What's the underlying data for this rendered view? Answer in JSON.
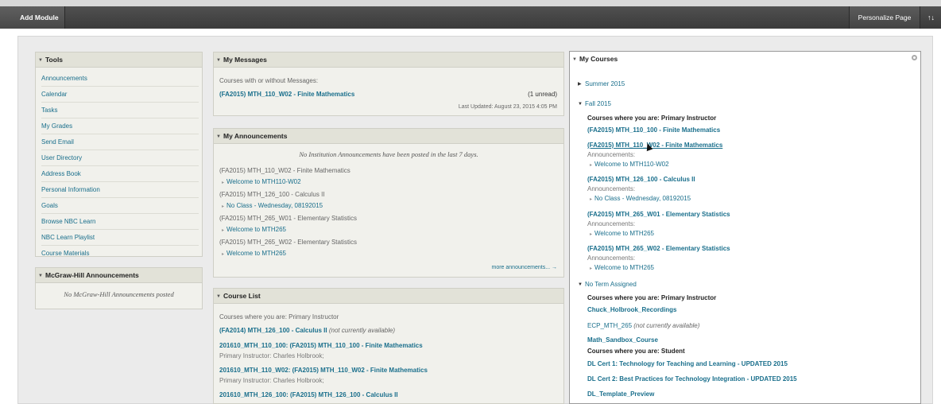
{
  "toolbar": {
    "add_module": "Add Module",
    "personalize_page": "Personalize Page",
    "sort_icon": "↑↓"
  },
  "tools": {
    "title": "Tools",
    "items": [
      "Announcements",
      "Calendar",
      "Tasks",
      "My Grades",
      "Send Email",
      "User Directory",
      "Address Book",
      "Personal Information",
      "Goals",
      "Browse NBC Learn",
      "NBC Learn Playlist",
      "Course Materials"
    ]
  },
  "mcgraw": {
    "title": "McGraw-Hill Announcements",
    "empty": "No McGraw-Hill Announcements posted"
  },
  "messages": {
    "title": "My Messages",
    "intro": "Courses with or without Messages:",
    "course": "(FA2015) MTH_110_W02 - Finite Mathematics",
    "unread": "(1 unread)",
    "updated": "Last Updated: August 23, 2015 4:05 PM"
  },
  "announcements": {
    "title": "My Announcements",
    "none": "No Institution Announcements have been posted in the last 7 days.",
    "items": [
      {
        "course": "(FA2015) MTH_110_W02 - Finite Mathematics",
        "link": "Welcome to MTH110-W02"
      },
      {
        "course": "(FA2015) MTH_126_100 - Calculus II",
        "link": "No Class - Wednesday, 08192015"
      },
      {
        "course": "(FA2015) MTH_265_W01 - Elementary Statistics",
        "link": "Welcome to MTH265"
      },
      {
        "course": "(FA2015) MTH_265_W02 - Elementary Statistics",
        "link": "Welcome to MTH265"
      }
    ],
    "more": "more announcements... →"
  },
  "course_list": {
    "title": "Course List",
    "role": "Courses where you are: Primary Instructor",
    "c1": "(FA2014) MTH_126_100 - Calculus II",
    "c1_note": "(not currently available)",
    "c2": "201610_MTH_110_100: (FA2015) MTH_110_100 - Finite Mathematics",
    "c2_sub": "Primary Instructor: Charles Holbrook;",
    "c3": "201610_MTH_110_W02: (FA2015) MTH_110_W02 - Finite Mathematics",
    "c3_sub": "Primary Instructor: Charles Holbrook;",
    "c4": "201610_MTH_126_100: (FA2015) MTH_126_100 - Calculus II"
  },
  "my_courses": {
    "title": "My Courses",
    "summer": "Summer 2015",
    "fall": "Fall 2015",
    "fall_role": "Courses where you are: Primary Instructor",
    "f1": "(FA2015) MTH_110_100 - Finite Mathematics",
    "f2": "(FA2015) MTH_110_W02 - Finite Mathematics",
    "f2_ann_label": "Announcements:",
    "f2_ann": "Welcome to MTH110-W02",
    "f3": "(FA2015) MTH_126_100 - Calculus II",
    "f3_ann_label": "Announcements:",
    "f3_ann": "No Class - Wednesday, 08192015",
    "f4": "(FA2015) MTH_265_W01 - Elementary Statistics",
    "f4_ann_label": "Announcements:",
    "f4_ann": "Welcome to MTH265",
    "f5": "(FA2015) MTH_265_W02 - Elementary Statistics",
    "f5_ann_label": "Announcements:",
    "f5_ann": "Welcome to MTH265",
    "no_term": "No Term Assigned",
    "nt_role": "Courses where you are: Primary Instructor",
    "nt1": "Chuck_Holbrook_Recordings",
    "nt2": "ECP_MTH_265",
    "nt2_note": "(not currently available)",
    "nt3": "Math_Sandbox_Course",
    "student_role": "Courses where you are: Student",
    "s1": "DL Cert 1: Technology for Teaching and Learning - UPDATED 2015",
    "s2": "DL Cert 2: Best Practices for Technology Integration - UPDATED 2015",
    "s3": "DL_Template_Preview"
  }
}
